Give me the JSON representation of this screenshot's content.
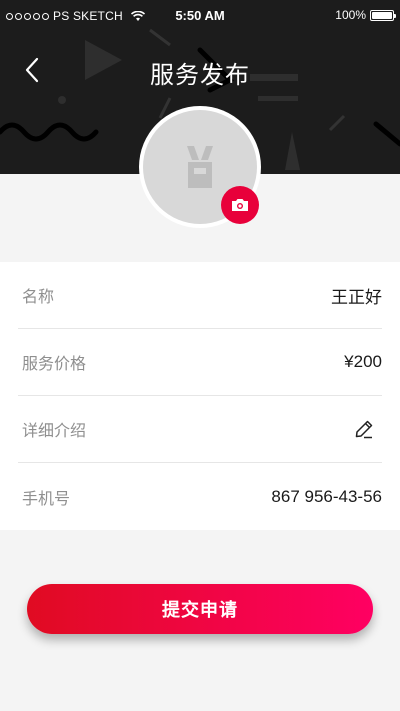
{
  "status_bar": {
    "carrier": "PS SKETCH",
    "time": "5:50 AM",
    "battery": "100%",
    "battery_level": 1.0
  },
  "nav": {
    "back_icon": "chevron-left-icon",
    "title": "服务发布"
  },
  "avatar": {
    "placeholder_icon": "bunny-placeholder-icon",
    "camera_icon": "camera-icon"
  },
  "form": {
    "rows": [
      {
        "label": "名称",
        "value": "王正好"
      },
      {
        "label": "服务价格",
        "value": "¥200"
      },
      {
        "label": "详细介绍",
        "value": "",
        "icon": "edit-pencil-icon"
      },
      {
        "label": "手机号",
        "value": "867 956-43-56"
      }
    ]
  },
  "submit": {
    "label": "提交申请"
  },
  "colors": {
    "accent": "#e8003a",
    "gradient_start": "#e00b22",
    "gradient_end": "#ff0062",
    "header_bg": "#1c1c1c",
    "page_bg": "#f4f4f4",
    "label_gray": "#8f8f8f"
  }
}
